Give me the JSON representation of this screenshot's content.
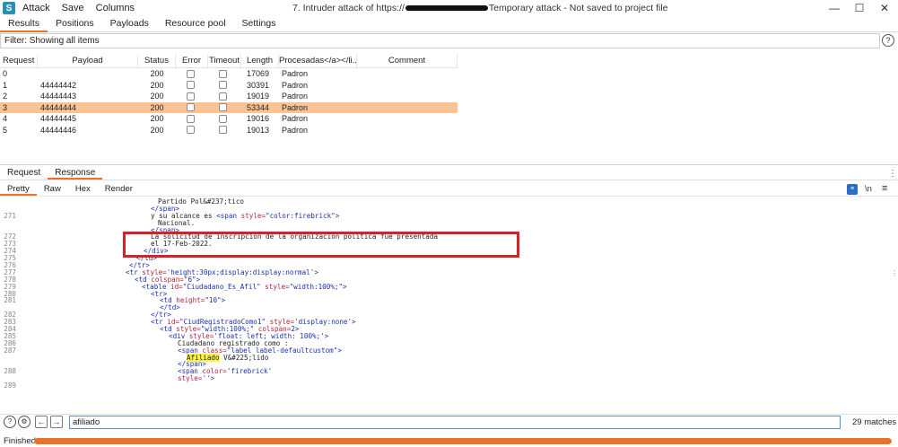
{
  "titlebar": {
    "app_icon_letter": "S",
    "menu": [
      "Attack",
      "Save",
      "Columns"
    ],
    "title_prefix": "7. Intruder attack of https://",
    "title_suffix": "Temporary attack - Not saved to project file",
    "controls": [
      "—",
      "☐",
      "✕"
    ]
  },
  "tabs": [
    "Results",
    "Positions",
    "Payloads",
    "Resource pool",
    "Settings"
  ],
  "filter": {
    "text": "Filter: Showing all items"
  },
  "table": {
    "columns": [
      "Request",
      "Payload",
      "Status",
      "Error",
      "Timeout",
      "Length",
      "Procesadas</a></li...",
      "Comment"
    ],
    "rows": [
      {
        "request": "0",
        "payload": "",
        "status": "200",
        "length": "17069",
        "procesadas": "Padron",
        "selected": false
      },
      {
        "request": "1",
        "payload": "44444442",
        "status": "200",
        "length": "30391",
        "procesadas": "Padron",
        "selected": false
      },
      {
        "request": "2",
        "payload": "44444443",
        "status": "200",
        "length": "19019",
        "procesadas": "Padron",
        "selected": false
      },
      {
        "request": "3",
        "payload": "44444444",
        "status": "200",
        "length": "53344",
        "procesadas": "Padron",
        "selected": true
      },
      {
        "request": "4",
        "payload": "44444445",
        "status": "200",
        "length": "19016",
        "procesadas": "Padron",
        "selected": false
      },
      {
        "request": "5",
        "payload": "44444446",
        "status": "200",
        "length": "19013",
        "procesadas": "Padron",
        "selected": false
      }
    ]
  },
  "message_tabs": [
    "Request",
    "Response"
  ],
  "view_tabs": [
    "Pretty",
    "Raw",
    "Hex",
    "Render"
  ],
  "view_icons": {
    "newline": "\\n",
    "menu": "≡",
    "kebab": "⋮"
  },
  "code_lines": [
    {
      "ln": "",
      "indent": 176,
      "parts": [
        {
          "t": "txt",
          "v": "Partido Pol&#237;tico"
        }
      ]
    },
    {
      "ln": "",
      "indent": 168,
      "parts": [
        {
          "t": "tag",
          "v": "</span>"
        }
      ]
    },
    {
      "ln": "271",
      "indent": 168,
      "parts": [
        {
          "t": "txt",
          "v": "y su alcance es "
        },
        {
          "t": "tag",
          "v": "<span "
        },
        {
          "t": "attr",
          "v": "style="
        },
        {
          "t": "tag",
          "v": "\"color:firebrick\">"
        }
      ]
    },
    {
      "ln": "",
      "indent": 176,
      "parts": [
        {
          "t": "txt",
          "v": "Nacional."
        }
      ]
    },
    {
      "ln": "",
      "indent": 168,
      "parts": [
        {
          "t": "tag",
          "v": "</span>"
        }
      ]
    },
    {
      "ln": "272",
      "indent": 168,
      "parts": [
        {
          "t": "txt",
          "v": "La solicitud de inscripción de la organización política fue presentada"
        }
      ]
    },
    {
      "ln": "273",
      "indent": 168,
      "parts": [
        {
          "t": "txt",
          "v": "el 17-Feb-2022."
        }
      ]
    },
    {
      "ln": "274",
      "indent": 160,
      "parts": [
        {
          "t": "tag",
          "v": "</div>"
        }
      ]
    },
    {
      "ln": "275",
      "indent": 152,
      "parts": [
        {
          "t": "tag",
          "v": "</td>"
        }
      ]
    },
    {
      "ln": "276",
      "indent": 144,
      "parts": [
        {
          "t": "tag",
          "v": "</tr>"
        }
      ]
    },
    {
      "ln": "277",
      "indent": 140,
      "parts": [
        {
          "t": "tag",
          "v": "<tr "
        },
        {
          "t": "attr",
          "v": "style="
        },
        {
          "t": "tag",
          "v": "'height:30px;display:display:normal'>"
        }
      ]
    },
    {
      "ln": "278",
      "indent": 150,
      "parts": [
        {
          "t": "tag",
          "v": "<td "
        },
        {
          "t": "attr",
          "v": "colspan="
        },
        {
          "t": "tag",
          "v": "\"6\">"
        }
      ]
    },
    {
      "ln": "279",
      "indent": 158,
      "parts": [
        {
          "t": "tag",
          "v": "<table "
        },
        {
          "t": "attr",
          "v": "id="
        },
        {
          "t": "tag",
          "v": "\"Ciudadano_Es_Afil\" "
        },
        {
          "t": "attr",
          "v": "style="
        },
        {
          "t": "tag",
          "v": "\"width:100%;\">"
        }
      ]
    },
    {
      "ln": "280",
      "indent": 168,
      "parts": [
        {
          "t": "tag",
          "v": "<tr>"
        }
      ]
    },
    {
      "ln": "281",
      "indent": 178,
      "parts": [
        {
          "t": "tag",
          "v": "<td "
        },
        {
          "t": "attr",
          "v": "height="
        },
        {
          "t": "tag",
          "v": "\"10\">"
        }
      ]
    },
    {
      "ln": "",
      "indent": 178,
      "parts": [
        {
          "t": "tag",
          "v": "</td>"
        }
      ]
    },
    {
      "ln": "282",
      "indent": 168,
      "parts": [
        {
          "t": "tag",
          "v": "</tr>"
        }
      ]
    },
    {
      "ln": "283",
      "indent": 168,
      "parts": [
        {
          "t": "tag",
          "v": "<tr "
        },
        {
          "t": "attr",
          "v": "id="
        },
        {
          "t": "tag",
          "v": "\"CiudRegistradoComo1\" "
        },
        {
          "t": "attr",
          "v": "style="
        },
        {
          "t": "tag",
          "v": "'display:none'>"
        }
      ]
    },
    {
      "ln": "284",
      "indent": 178,
      "parts": [
        {
          "t": "tag",
          "v": "<td "
        },
        {
          "t": "attr",
          "v": "style="
        },
        {
          "t": "tag",
          "v": "\"width:100%;\" "
        },
        {
          "t": "attr",
          "v": "colspan="
        },
        {
          "t": "tag",
          "v": "2>"
        }
      ]
    },
    {
      "ln": "285",
      "indent": 188,
      "parts": [
        {
          "t": "tag",
          "v": "<div "
        },
        {
          "t": "attr",
          "v": "style="
        },
        {
          "t": "tag",
          "v": "'float: left; width: 100%;'>"
        }
      ]
    },
    {
      "ln": "286",
      "indent": 198,
      "parts": [
        {
          "t": "txt",
          "v": "Ciudadano registrado como :"
        }
      ]
    },
    {
      "ln": "287",
      "indent": 198,
      "parts": [
        {
          "t": "tag",
          "v": "<span "
        },
        {
          "t": "attr",
          "v": "class="
        },
        {
          "t": "tag",
          "v": "\"label label-defaultcustom\">"
        }
      ]
    },
    {
      "ln": "",
      "indent": 208,
      "parts": [
        {
          "t": "hl",
          "v": "Afiliado"
        },
        {
          "t": "txt",
          "v": " V&#225;lido"
        }
      ]
    },
    {
      "ln": "",
      "indent": 198,
      "parts": [
        {
          "t": "tag",
          "v": "</span>"
        }
      ]
    },
    {
      "ln": "288",
      "indent": 198,
      "parts": [
        {
          "t": "tag",
          "v": "<span "
        },
        {
          "t": "attr",
          "v": "color="
        },
        {
          "t": "tag",
          "v": "'firebrick'"
        }
      ]
    },
    {
      "ln": "",
      "indent": 198,
      "parts": [
        {
          "t": "attr",
          "v": "style="
        },
        {
          "t": "tag",
          "v": "''>"
        }
      ]
    },
    {
      "ln": "289",
      "indent": 208,
      "parts": [
        {
          "t": "txt",
          "v": ""
        }
      ]
    }
  ],
  "search": {
    "value": "afiliado",
    "matches": "29 matches"
  },
  "status": {
    "label": "Finished",
    "progress_percent": 100
  },
  "colors": {
    "accent": "#e8742a",
    "selected_row": "#fbc495",
    "highlight_box": "#d2232a",
    "search_highlight": "#fff34a"
  }
}
